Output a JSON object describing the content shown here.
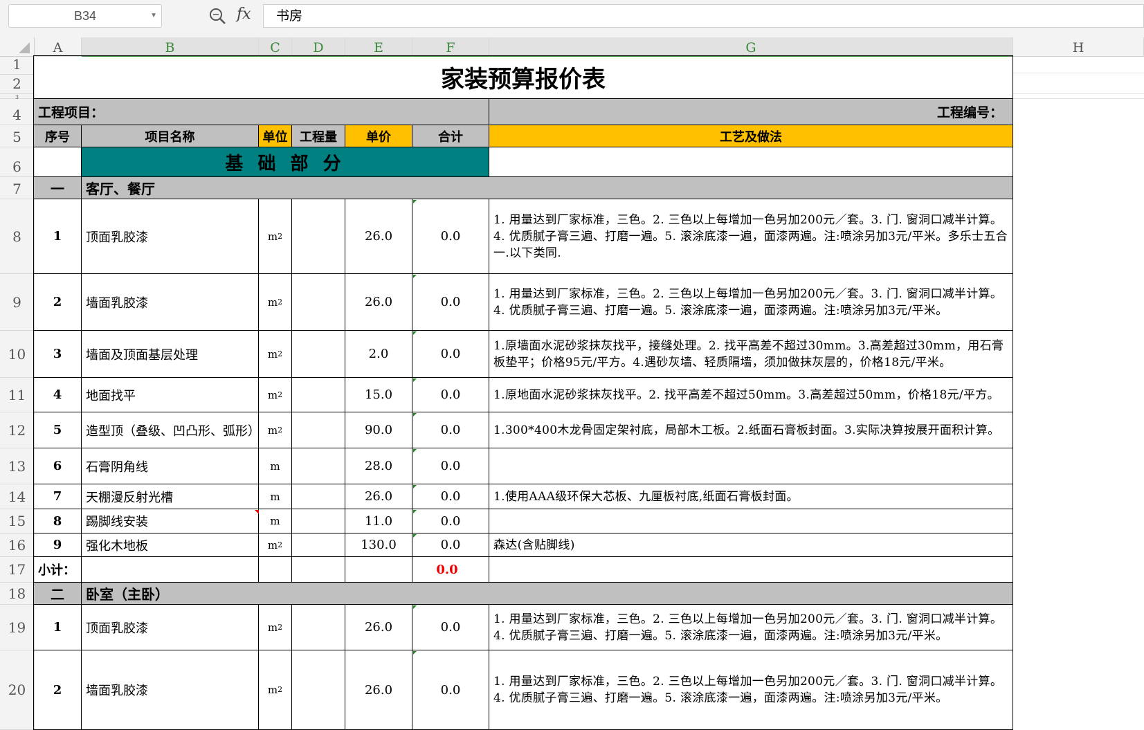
{
  "formula_bar": {
    "cell_ref": "B34",
    "fx_label": "fx",
    "formula_value": "书房"
  },
  "columns": [
    "A",
    "B",
    "C",
    "D",
    "E",
    "F",
    "G",
    "H"
  ],
  "row_numbers": [
    "1",
    "2",
    "3",
    "4",
    "5",
    "6",
    "7",
    "8",
    "9",
    "10",
    "11",
    "12",
    "13",
    "14",
    "15",
    "16",
    "17",
    "18",
    "19",
    "20"
  ],
  "sheet": {
    "title": "家装预算报价表",
    "project_label": "工程项目：",
    "project_no_label": "工程编号：",
    "headers": {
      "no": "序号",
      "name": "项目名称",
      "unit": "单位",
      "qty": "工程量",
      "price": "单价",
      "total": "合计",
      "method": "工艺及做法"
    },
    "section_basic": "基 础 部 分",
    "group1": {
      "num": "一",
      "name": "客厅、餐厅"
    },
    "group2": {
      "num": "二",
      "name": "卧室（主卧）"
    },
    "subtotal": {
      "label": "小计：",
      "value": "0.0"
    },
    "items": [
      {
        "no": "1",
        "name": "顶面乳胶漆",
        "unit": "m",
        "sup": "2",
        "price": "26.0",
        "total": "0.0",
        "desc": "1. 用量达到厂家标准，三色。2. 三色以上每增加一色另加200元／套。3. 门. 窗洞口减半计算。4. 优质腻子膏三遍、打磨一遍。5. 滚涂底漆一遍，面漆两遍。注:喷涂另加3元/平米。多乐士五合一.以下类同."
      },
      {
        "no": "2",
        "name": "墙面乳胶漆",
        "unit": "m",
        "sup": "2",
        "price": "26.0",
        "total": "0.0",
        "desc": "1. 用量达到厂家标准，三色。2. 三色以上每增加一色另加200元／套。3. 门. 窗洞口减半计算。4. 优质腻子膏三遍、打磨一遍。5. 滚涂底漆一遍，面漆两遍。注:喷涂另加3元/平米。"
      },
      {
        "no": "3",
        "name": "墙面及顶面基层处理",
        "unit": "m",
        "sup": "2",
        "price": "2.0",
        "total": "0.0",
        "desc": "1.原墙面水泥砂浆抹灰找平，接缝处理。2. 找平高差不超过30mm。3.高差超过30mm，用石膏板垫平；价格95元/平方。4.遇砂灰墙、轻质隔墙，须加做抹灰层的，价格18元/平米。"
      },
      {
        "no": "4",
        "name": "地面找平",
        "unit": "m",
        "sup": "2",
        "price": "15.0",
        "total": "0.0",
        "desc": "1.原地面水泥砂浆抹灰找平。2. 找平高差不超过50mm。3.高差超过50mm，价格18元/平方。"
      },
      {
        "no": "5",
        "name": "造型顶（叠级、凹凸形、弧形）",
        "unit": "m",
        "sup": "2",
        "price": "90.0",
        "total": "0.0",
        "desc": "1.300*400木龙骨固定架衬底，局部木工板。2.纸面石膏板封面。3.实际决算按展开面积计算。"
      },
      {
        "no": "6",
        "name": "石膏阴角线",
        "unit": "m",
        "sup": "",
        "price": "28.0",
        "total": "0.0",
        "desc": ""
      },
      {
        "no": "7",
        "name": "天棚漫反射光槽",
        "unit": "m",
        "sup": "",
        "price": "26.0",
        "total": "0.0",
        "desc": "1.使用AAA级环保大芯板、九厘板衬底,纸面石膏板封面。"
      },
      {
        "no": "8",
        "name": "踢脚线安装",
        "unit": "m",
        "sup": "",
        "price": "11.0",
        "total": "0.0",
        "desc": ""
      },
      {
        "no": "9",
        "name": "强化木地板",
        "unit": "m",
        "sup": "2",
        "price": "130.0",
        "total": "0.0",
        "desc": "森达(含贴脚线)"
      }
    ],
    "items2": [
      {
        "no": "1",
        "name": "顶面乳胶漆",
        "unit": "m",
        "sup": "2",
        "price": "26.0",
        "total": "0.0",
        "desc": "1. 用量达到厂家标准，三色。2. 三色以上每增加一色另加200元／套。3. 门. 窗洞口减半计算。4. 优质腻子膏三遍、打磨一遍。5. 滚涂底漆一遍，面漆两遍。注:喷涂另加3元/平米。"
      },
      {
        "no": "2",
        "name": "墙面乳胶漆",
        "unit": "m",
        "sup": "2",
        "price": "26.0",
        "total": "0.0",
        "desc": "1. 用量达到厂家标准，三色。2. 三色以上每增加一色另加200元／套。3. 门. 窗洞口减半计算。4. 优质腻子膏三遍、打磨一遍。5. 滚涂底漆一遍，面漆两遍。注:喷涂另加3元/平米。"
      }
    ]
  },
  "colors": {
    "header_gray": "#c0c0c0",
    "header_gold": "#ffc000",
    "section_teal": "#008080",
    "subtotal_red": "#e00000",
    "selected_col": "#3a8a3a"
  }
}
